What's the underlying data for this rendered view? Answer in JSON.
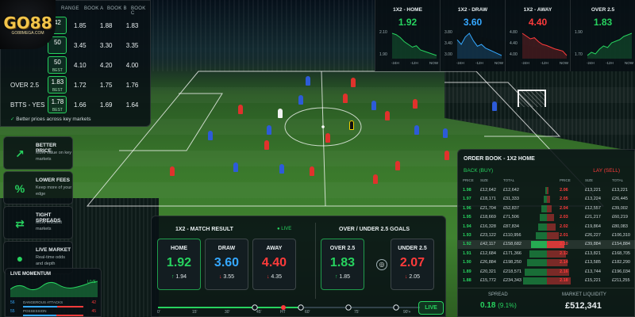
{
  "brand": {
    "name": "GO88",
    "sub": "GO88MEGA.COM"
  },
  "odds_table": {
    "headers": [
      "RANGE",
      "BOOK A",
      "BOOK B",
      "BOOK C"
    ],
    "rows": [
      {
        "label": "",
        "best": "42",
        "best_tag": "",
        "a": "1.85",
        "b": "1.88",
        "c": "1.83"
      },
      {
        "label": "",
        "best": "50",
        "best_tag": "",
        "a": "3.45",
        "b": "3.30",
        "c": "3.35"
      },
      {
        "label": "",
        "best": "50",
        "best_tag": "BEST",
        "a": "4.10",
        "b": "4.20",
        "c": "4.00"
      },
      {
        "label": "OVER 2.5",
        "best": "1.83",
        "best_tag": "BEST",
        "a": "1.72",
        "b": "1.75",
        "c": "1.76"
      },
      {
        "label": "BTTS - YES",
        "best": "1.78",
        "best_tag": "BEST",
        "a": "1.66",
        "b": "1.69",
        "c": "1.64"
      }
    ],
    "footer": "Better prices across key markets"
  },
  "features": [
    {
      "title": "BETTER PRICE",
      "desc": "More value on key markets",
      "icon": "trend-up-icon",
      "glyph": "↗"
    },
    {
      "title": "LOWER FEES",
      "desc": "Keep more of your edge",
      "icon": "percent-icon",
      "glyph": "%"
    },
    {
      "title": "TIGHT SPREADS",
      "desc": "More efficient markets",
      "icon": "spread-arrows-icon",
      "glyph": "⇄"
    },
    {
      "title": "LIVE MARKET",
      "desc": "Real-time odds and depth",
      "icon": "live-dot-icon",
      "glyph": "●"
    }
  ],
  "momentum": {
    "title": "LIVE MOMENTUM",
    "live": "LIVE",
    "rows": [
      {
        "left": "56",
        "label": "DANGEROUS ATTACKS",
        "right": "42"
      },
      {
        "left": "55",
        "label": "POSSESSION",
        "right": "45"
      }
    ]
  },
  "mini_charts": [
    {
      "title": "1X2 - HOME",
      "value": "1.92",
      "color": "#27d35f",
      "y": [
        "2.10",
        "1.90"
      ],
      "x": [
        "-24H",
        "-12H",
        "NOW"
      ],
      "series": [
        2.08,
        2.07,
        2.05,
        2.02,
        2.0,
        1.98,
        1.99,
        1.96,
        1.95,
        1.94,
        1.93,
        1.92
      ]
    },
    {
      "title": "1X2 - DRAW",
      "value": "3.60",
      "color": "#35a8ff",
      "y": [
        "3.80",
        "3.40",
        "3.00"
      ],
      "x": [
        "-24H",
        "-12H",
        "NOW"
      ],
      "series": [
        3.55,
        3.5,
        3.58,
        3.62,
        3.54,
        3.48,
        3.5,
        3.46,
        3.44,
        3.42,
        3.4,
        3.38
      ]
    },
    {
      "title": "1X2 - AWAY",
      "value": "4.40",
      "color": "#ff3b3b",
      "y": [
        "4.80",
        "4.40",
        "4.00"
      ],
      "x": [
        "-24H",
        "-12H",
        "NOW"
      ],
      "series": [
        4.7,
        4.65,
        4.6,
        4.62,
        4.55,
        4.5,
        4.48,
        4.45,
        4.42,
        4.4,
        4.38,
        4.3
      ]
    },
    {
      "title": "OVER 2.5",
      "value": "1.83",
      "color": "#27d35f",
      "y": [
        "1.90",
        "1.70"
      ],
      "x": [
        "-24H",
        "-12H",
        "NOW"
      ],
      "series": [
        1.72,
        1.74,
        1.73,
        1.76,
        1.78,
        1.77,
        1.8,
        1.81,
        1.82,
        1.84,
        1.85,
        1.86
      ]
    }
  ],
  "order_book": {
    "title": "ORDER BOOK - 1X2 HOME",
    "back_label": "BACK (BUY)",
    "lay_label": "LAY (SELL)",
    "headers": [
      "PRICE",
      "SIZE",
      "TOTAL",
      "PRICE",
      "SIZE",
      "TOTAL"
    ],
    "back": [
      [
        "1.98",
        "£12,642",
        "£12,642"
      ],
      [
        "1.97",
        "£18,171",
        "£31,333"
      ],
      [
        "1.96",
        "£21,704",
        "£52,837"
      ],
      [
        "1.95",
        "£18,669",
        "£71,506"
      ],
      [
        "1.94",
        "£16,328",
        "£87,834"
      ],
      [
        "1.93",
        "£23,122",
        "£110,956"
      ],
      [
        "1.92",
        "£42,117",
        "£158,682"
      ],
      [
        "1.91",
        "£12,684",
        "£171,366"
      ],
      [
        "1.90",
        "£26,884",
        "£198,250"
      ],
      [
        "1.89",
        "£20,321",
        "£218,571"
      ],
      [
        "1.88",
        "£15,772",
        "£234,343"
      ]
    ],
    "lay": [
      [
        "2.06",
        "£13,221",
        "£13,221"
      ],
      [
        "2.05",
        "£13,224",
        "£26,445"
      ],
      [
        "2.04",
        "£12,557",
        "£39,002"
      ],
      [
        "2.03",
        "£21,217",
        "£60,219"
      ],
      [
        "2.02",
        "£19,864",
        "£80,083"
      ],
      [
        "2.01",
        "£26,227",
        "£106,310"
      ],
      [
        "2.10",
        "£39,884",
        "£154,884"
      ],
      [
        "2.12",
        "£13,821",
        "£168,705"
      ],
      [
        "2.14",
        "£13,585",
        "£182,290"
      ],
      [
        "2.16",
        "£13,744",
        "£196,034"
      ],
      [
        "2.18",
        "£15,221",
        "£211,255"
      ]
    ],
    "spread_label": "SPREAD",
    "spread_value": "0.18",
    "spread_pct": "(9.1%)",
    "liquidity_label": "MARKET LIQUIDITY",
    "liquidity_value": "£512,341"
  },
  "match": {
    "title_1x2": "1X2 - MATCH RESULT",
    "title_ou": "OVER / UNDER 2.5 GOALS",
    "live": "LIVE",
    "markets": [
      {
        "label": "HOME",
        "odds": "1.92",
        "change": "1.94",
        "dir": "up",
        "color": "#27d35f"
      },
      {
        "label": "DRAW",
        "odds": "3.60",
        "change": "3.55",
        "dir": "down",
        "color": "#35a8ff"
      },
      {
        "label": "AWAY",
        "odds": "4.40",
        "change": "4.35",
        "dir": "down",
        "color": "#ff3b3b"
      },
      {
        "label": "OVER 2.5",
        "odds": "1.83",
        "change": "1.85",
        "dir": "up",
        "color": "#27d35f"
      },
      {
        "label": "UNDER 2.5",
        "odds": "2.07",
        "change": "2.05",
        "dir": "down",
        "color": "#ff3b3b"
      }
    ],
    "timeline": [
      "0'",
      "15'",
      "30'",
      "45'",
      "HT",
      "60'",
      "75'",
      "90'+"
    ],
    "live_button": "LIVE"
  }
}
